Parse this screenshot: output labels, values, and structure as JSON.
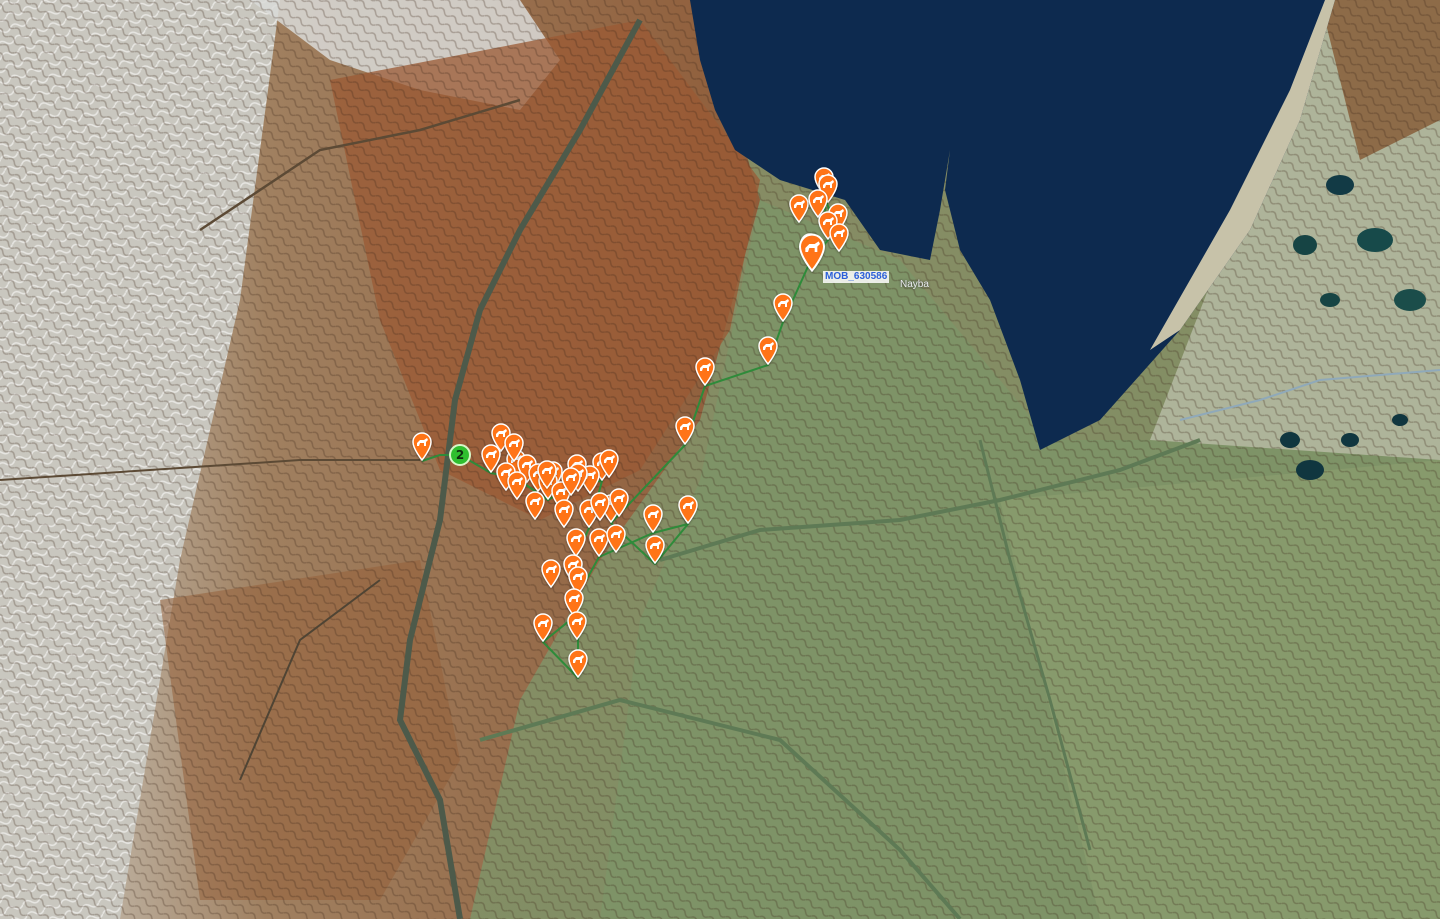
{
  "map": {
    "object_label": "MOB_630586",
    "place_label": "Nayba",
    "cluster_count": "2",
    "marker_icon": "moose-icon",
    "marker_color": "#ff7417",
    "track_color": "#2e8b3a",
    "cluster_color": "#2fbf2f",
    "label_color": "#2b5fd9",
    "basemap": "satellite imagery"
  }
}
